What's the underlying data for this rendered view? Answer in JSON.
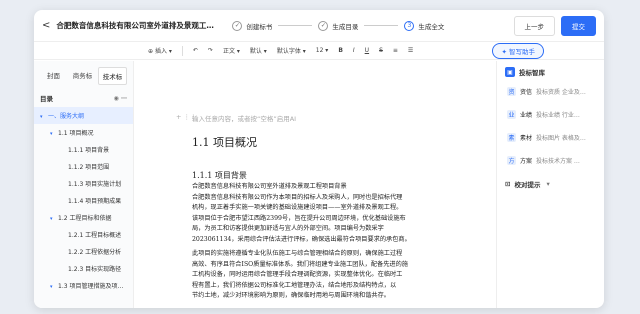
{
  "topbar": {
    "back_glyph": "<",
    "title": "合肥数音信息科技有限公司室外道排及景观工…",
    "steps": [
      {
        "label": "创建标书",
        "check": "✓"
      },
      {
        "label": "生成目录",
        "check": "✓"
      },
      {
        "label": "生成全文",
        "check": "3"
      }
    ],
    "prev_label": "上一步",
    "submit_label": "提交"
  },
  "toolbar": {
    "insert": "插入",
    "body_text": "正文",
    "font_default": "默认",
    "font_family": "默认字体",
    "font_size": "12",
    "bold": "B",
    "italic": "I",
    "underline": "U",
    "strike": "S",
    "ai_assistant": "智写助手"
  },
  "left": {
    "tabs": [
      "封面",
      "商务标",
      "技术标"
    ],
    "toc_title": "目录",
    "toc_items": [
      {
        "label": "一、服务大纲",
        "level": 0,
        "caret": "▾",
        "selected": true
      },
      {
        "label": "1.1 项目概况",
        "level": 1,
        "caret": "▾"
      },
      {
        "label": "1.1.1 项目背景",
        "level": 2,
        "caret": ""
      },
      {
        "label": "1.1.2 项目范围",
        "level": 2,
        "caret": ""
      },
      {
        "label": "1.1.3 项目实施计划",
        "level": 2,
        "caret": ""
      },
      {
        "label": "1.1.4 项目预期成果",
        "level": 2,
        "caret": ""
      },
      {
        "label": "1.2 工程目标和依据",
        "level": 1,
        "caret": "▾"
      },
      {
        "label": "1.2.1 工程目标概述",
        "level": 2,
        "caret": ""
      },
      {
        "label": "1.2.2 工程依据分析",
        "level": 2,
        "caret": ""
      },
      {
        "label": "1.2.3 目标实现路径",
        "level": 2,
        "caret": ""
      },
      {
        "label": "1.3 项目管理措施及项…",
        "level": 1,
        "caret": "▾"
      }
    ]
  },
  "editor": {
    "placeholder": "输入任意内容，或者按“空格”启用AI",
    "h1": "1.1  项目概况",
    "h2": "1.1.1  项目背景",
    "para1_lines": [
      "合肥数音信息科技有限公司室外道排及景观工程项目背景",
      "合肥数音信息科技有限公司作为本项目的招标人及采购人，同时也是招标代理",
      "机构，现正着手实施一项关键的基础设施建设项目——室外道排及景观工程。",
      "该项目位于合肥市望江西路2399号，旨在提升公司周边环境，优化基础设施布",
      "局，为员工和访客提供更加舒适与宜人的外部空间。项目编号为数采字",
      "2023061134，采用综合评估法进行评标，确保选出最符合项目要求的承包商。"
    ],
    "para2_lines": [
      "此项目的实施将遵循专业化队伍施工与综合管理相结合的原则，确保施工过程",
      "高效、有序且符合ISO质量标准体系。我们将组建专业施工团队，配备先进的施",
      "工机构设备，同时运用综合管理手段合理调配资源，实现整体优化。在临时工",
      "程有置上，我们将依据公司标准化工地管理办法，结合地形及结构特点，以",
      "节约土地，减少对环境影响为原则，确保临时用地与周围环境和谐共存。"
    ]
  },
  "right": {
    "title": "投标智库",
    "items": [
      {
        "name": "资信",
        "desc": "投标资质 企业及…",
        "icon": "资"
      },
      {
        "name": "业绩",
        "desc": "投标业绩 行业…",
        "icon": "业"
      },
      {
        "name": "素材",
        "desc": "投标图片 表格及…",
        "icon": "素"
      },
      {
        "name": "方案",
        "desc": "投标技术方案 …",
        "icon": "方"
      }
    ],
    "check_title": "校对提示"
  }
}
